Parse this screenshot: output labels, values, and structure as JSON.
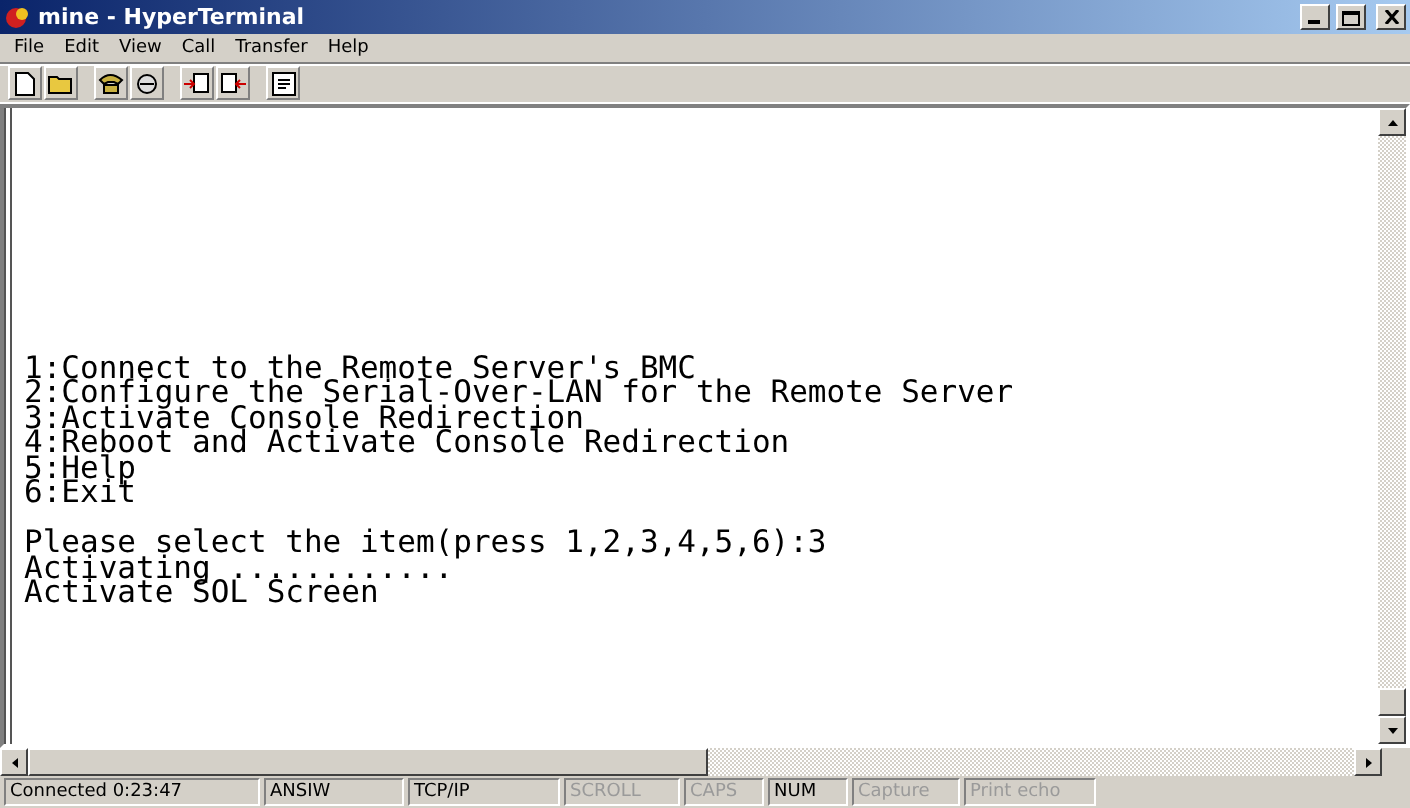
{
  "window": {
    "title": "mine - HyperTerminal"
  },
  "menu": [
    "File",
    "Edit",
    "View",
    "Call",
    "Transfer",
    "Help"
  ],
  "toolbar": [
    {
      "kind": "new"
    },
    {
      "kind": "open"
    },
    {
      "kind": "sep"
    },
    {
      "kind": "connect"
    },
    {
      "kind": "disconnect"
    },
    {
      "kind": "sep"
    },
    {
      "kind": "send"
    },
    {
      "kind": "receive"
    },
    {
      "kind": "sep"
    },
    {
      "kind": "properties"
    }
  ],
  "terminal": {
    "menu_lines": [
      "1:Connect to the Remote Server's BMC",
      "2:Configure the Serial-Over-LAN for the Remote Server",
      "3:Activate Console Redirection",
      "4:Reboot and Activate Console Redirection",
      "5:Help",
      "6:Exit"
    ],
    "output_lines": [
      "Please select the item(press 1,2,3,4,5,6):3",
      "Activating ............",
      "Activate SOL Screen"
    ]
  },
  "status_bar": [
    {
      "label": "Connected 0:23:47",
      "disabled": false
    },
    {
      "label": "ANSIW",
      "disabled": false
    },
    {
      "label": "TCP/IP",
      "disabled": false
    },
    {
      "label": "SCROLL",
      "disabled": true
    },
    {
      "label": "CAPS",
      "disabled": true
    },
    {
      "label": "NUM",
      "disabled": false
    },
    {
      "label": "Capture",
      "disabled": true
    },
    {
      "label": "Print echo",
      "disabled": true
    }
  ]
}
